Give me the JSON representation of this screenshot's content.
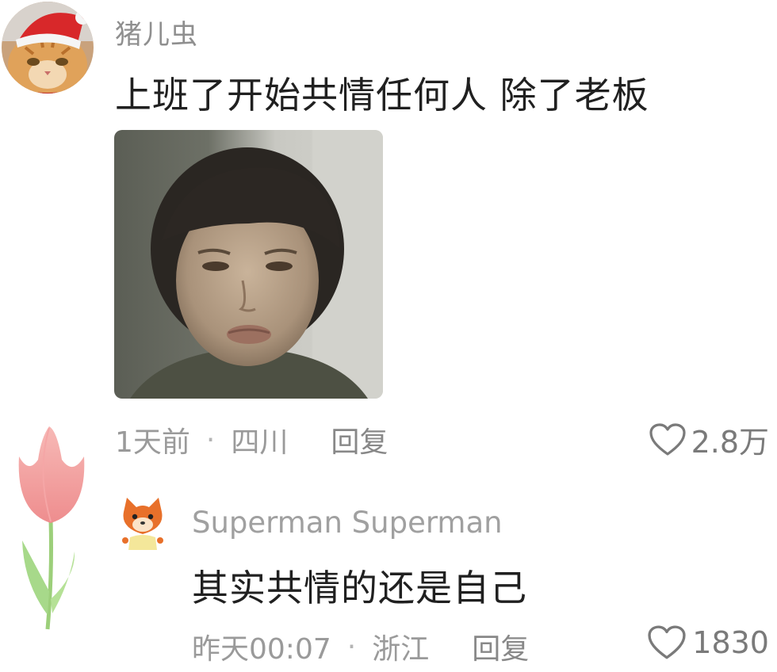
{
  "comment": {
    "author": "猪儿虫",
    "avatar": "cat-with-santa-hat",
    "text": "上班了开始共情任何人 除了老板",
    "image": "photo-of-person-pouting",
    "time": "1天前",
    "separator": "·",
    "location": "四川",
    "reply_label": "回复",
    "likes": "2.8万",
    "like_icon": "heart-outline-icon",
    "decoration": "pink-tulip-sticker"
  },
  "reply": {
    "author": "Superman Superman",
    "avatar": "cartoon-fox-avatar",
    "text": "其实共情的还是自己",
    "time": "昨天00:07",
    "separator": "·",
    "location": "浙江",
    "reply_label": "回复",
    "likes": "1830",
    "like_icon": "heart-outline-icon"
  },
  "colors": {
    "meta_text": "#9a9a9a",
    "main_text": "#202020",
    "author_text": "#8f8f8f"
  }
}
